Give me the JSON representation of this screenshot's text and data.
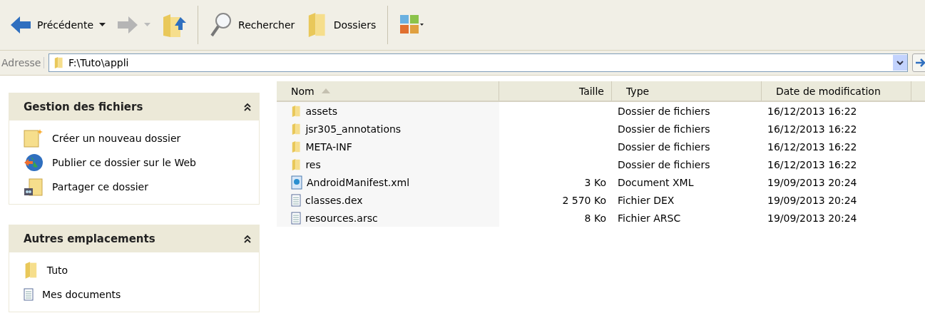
{
  "toolbar": {
    "back": {
      "label": "Précédente",
      "disabled": false
    },
    "forward": {
      "disabled": true
    },
    "search": {
      "label": "Rechercher"
    },
    "folders": {
      "label": "Dossiers"
    }
  },
  "address": {
    "label": "Adresse",
    "value": "F:\\Tuto\\appli"
  },
  "task_panels": [
    {
      "title": "Gestion des fichiers",
      "expanded": true,
      "items": [
        {
          "label": "Créer un nouveau dossier",
          "kind": "newfolder"
        },
        {
          "label": "Publier ce dossier sur le Web",
          "kind": "web"
        },
        {
          "label": "Partager ce dossier",
          "kind": "share"
        }
      ]
    },
    {
      "title": "Autres emplacements",
      "expanded": true,
      "items": [
        {
          "label": "Tuto",
          "kind": "folder"
        },
        {
          "label": "Mes documents",
          "kind": "document"
        }
      ]
    }
  ],
  "table": {
    "columns": [
      {
        "label": "Nom",
        "sorted": true
      },
      {
        "label": "Taille",
        "sorted": false
      },
      {
        "label": "Type",
        "sorted": false
      },
      {
        "label": "Date de modification",
        "sorted": false
      }
    ],
    "rows": [
      {
        "kind": "folder",
        "name": "assets",
        "size": "",
        "type": "Dossier de fichiers",
        "date": "16/12/2013 16:22"
      },
      {
        "kind": "folder",
        "name": "jsr305_annotations",
        "size": "",
        "type": "Dossier de fichiers",
        "date": "16/12/2013 16:22"
      },
      {
        "kind": "folder",
        "name": "META-INF",
        "size": "",
        "type": "Dossier de fichiers",
        "date": "16/12/2013 16:22"
      },
      {
        "kind": "folder",
        "name": "res",
        "size": "",
        "type": "Dossier de fichiers",
        "date": "16/12/2013 16:22"
      },
      {
        "kind": "xml",
        "name": "AndroidManifest.xml",
        "size": "3 Ko",
        "type": "Document XML",
        "date": "19/09/2013 20:24"
      },
      {
        "kind": "file",
        "name": "classes.dex",
        "size": "2 570 Ko",
        "type": "Fichier DEX",
        "date": "19/09/2013 20:24"
      },
      {
        "kind": "file",
        "name": "resources.arsc",
        "size": "8 Ko",
        "type": "Fichier ARSC",
        "date": "19/09/2013 20:24"
      }
    ]
  }
}
